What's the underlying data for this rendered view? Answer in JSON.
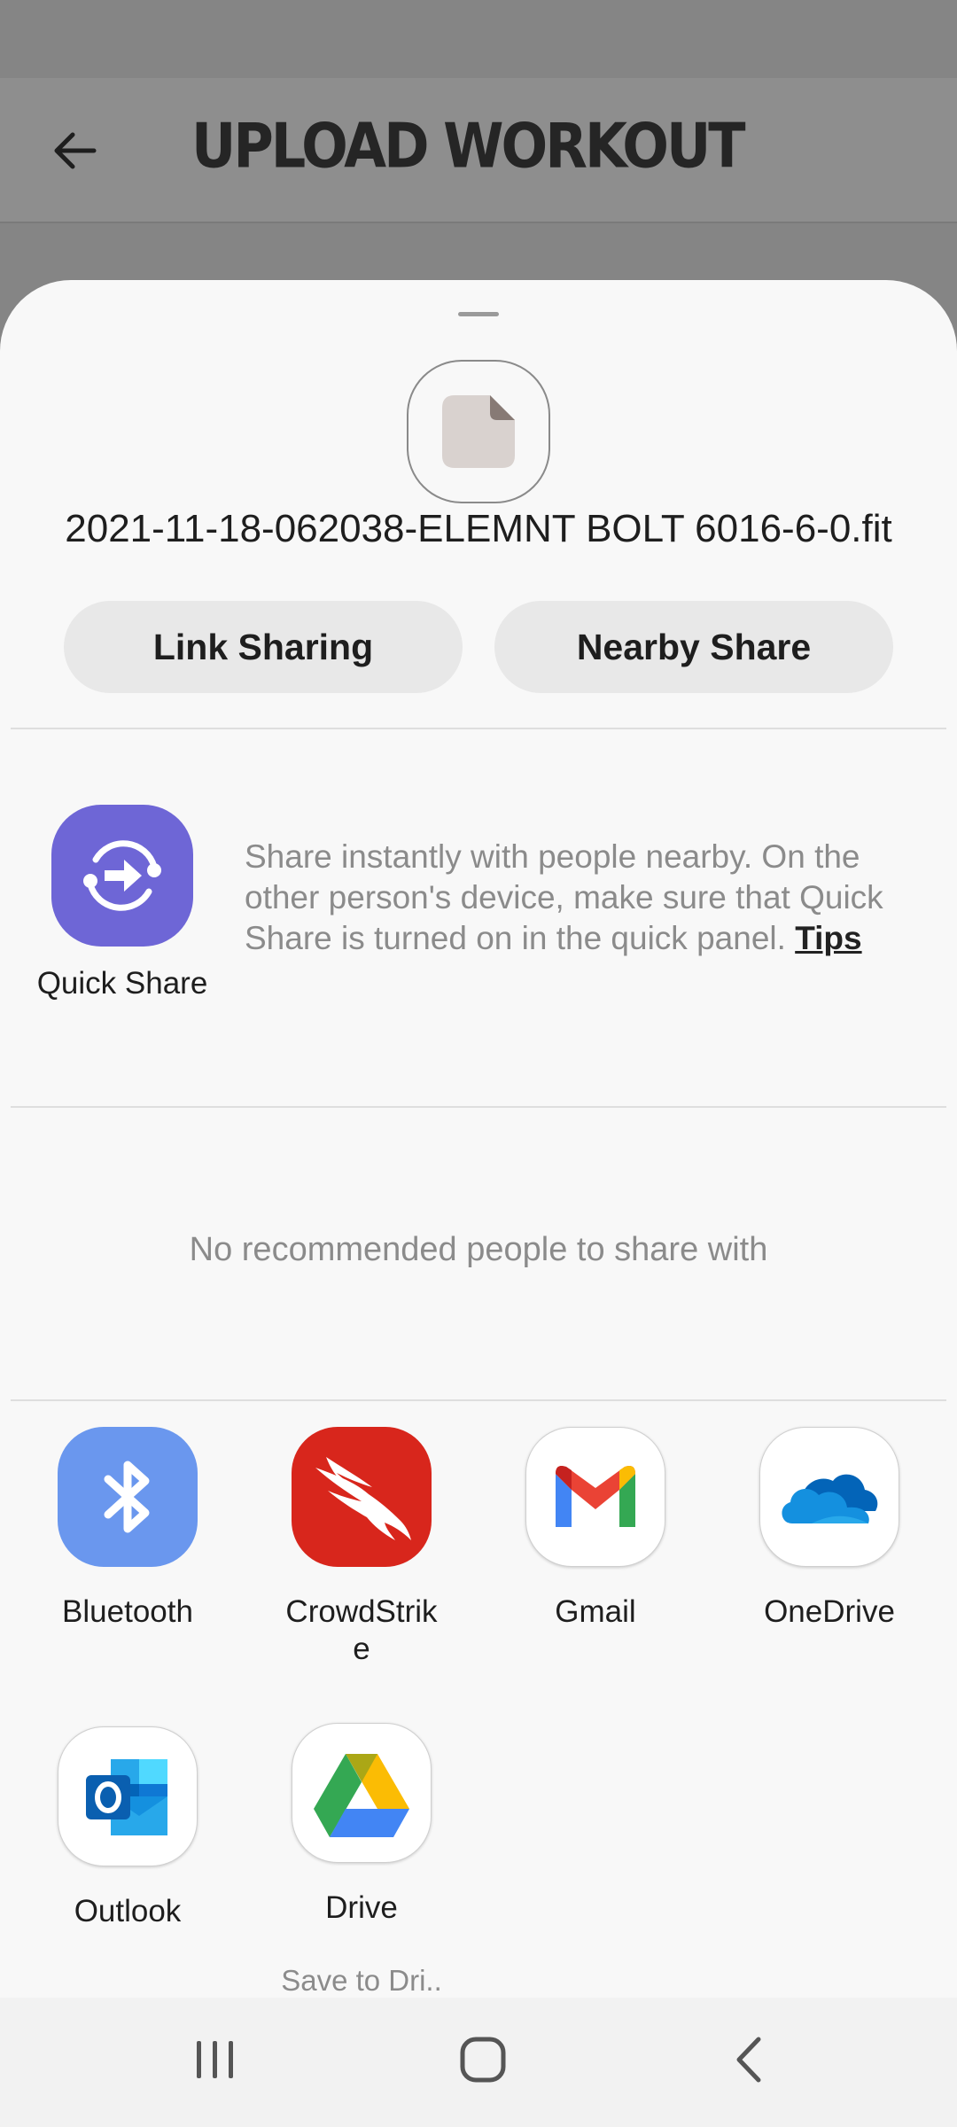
{
  "background": {
    "app_title": "UPLOAD WORKOUT"
  },
  "share_sheet": {
    "file_name": "2021-11-18-062038-ELEMNT BOLT 6016-6-0.fit",
    "buttons": {
      "link_sharing": "Link Sharing",
      "nearby_share": "Nearby Share"
    },
    "quick_share": {
      "label": "Quick Share",
      "description": "Share instantly with people nearby. On the other person's device, make sure that Quick Share is turned on in the quick panel.",
      "tips": "Tips",
      "color": "#6e66d6"
    },
    "no_recommendations": "No recommended people to share with",
    "apps": [
      {
        "label": "Bluetooth",
        "icon": "bluetooth-icon",
        "color": "#6a97ee"
      },
      {
        "label": "CrowdStrik\ne",
        "icon": "crowdstrike-falcon-icon",
        "color": "#d8261c"
      },
      {
        "label": "Gmail",
        "icon": "gmail-icon"
      },
      {
        "label": "OneDrive",
        "icon": "onedrive-icon"
      },
      {
        "label": "Outlook",
        "icon": "outlook-icon"
      },
      {
        "label": "Drive",
        "sublabel": "Save to Dri..",
        "icon": "google-drive-icon"
      }
    ]
  },
  "navigation": {
    "recents": "recents-icon",
    "home": "home-icon",
    "back": "back-icon"
  }
}
